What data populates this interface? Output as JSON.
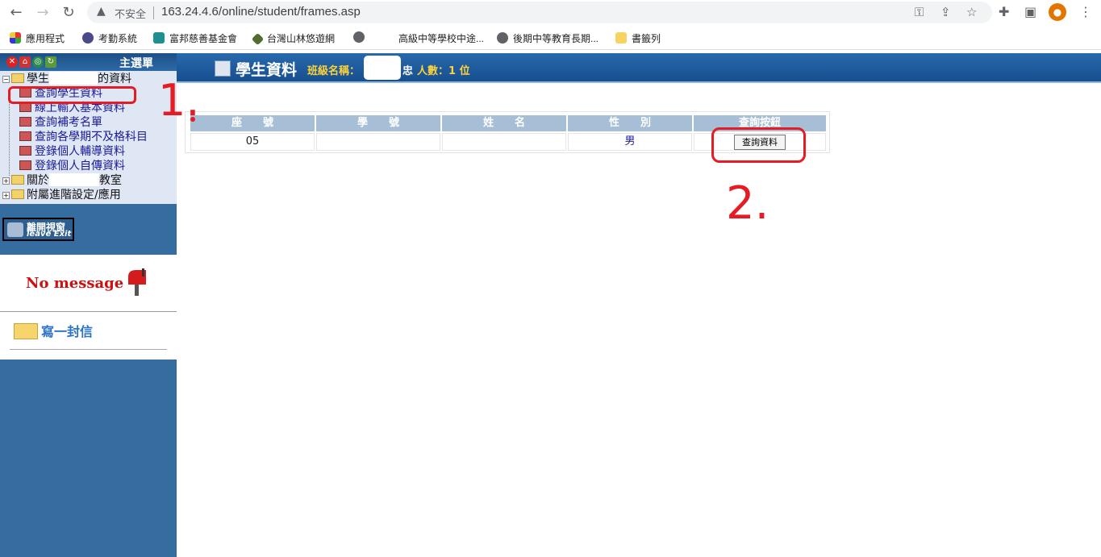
{
  "browser": {
    "insecure_label": "不安全",
    "url": "163.24.4.6/online/student/frames.asp",
    "bookmarks": [
      "應用程式",
      "考勤系統",
      "富邦慈善基金會",
      "台灣山林悠遊網",
      "",
      "高級中等學校中途...",
      "後期中等教育長期...",
      "書籤列"
    ]
  },
  "menu": {
    "title": "主選單",
    "tree": [
      {
        "label_a": "學生",
        "label_b": "的資料"
      },
      {
        "label": "查詢學生資料"
      },
      {
        "label": "線上輸入基本資料"
      },
      {
        "label": "查詢補考名單"
      },
      {
        "label": "查詢各學期不及格科目"
      },
      {
        "label": "登錄個人輔導資料"
      },
      {
        "label": "登錄個人自傳資料"
      },
      {
        "label_a": "關於",
        "label_b": "教室"
      },
      {
        "label": "附屬進階設定/應用"
      }
    ],
    "exit_label_top": "離開視窗",
    "exit_label_bottom": "leave Exit",
    "no_message": "No message",
    "write_letter": "寫一封信"
  },
  "banner": {
    "title": "學生資料",
    "class_label": "班級名稱：",
    "class_suffix": "忠",
    "count_label": "人數：1 位"
  },
  "table": {
    "headers": [
      "座　　號",
      "學　　號",
      "姓　　名",
      "性　　別",
      "查詢按鈕"
    ],
    "rows": [
      {
        "seat": "05",
        "student_id": "",
        "name": "",
        "gender": "男",
        "button": "查詢資料"
      }
    ]
  },
  "annotations": {
    "step1": "1.",
    "step2": "2."
  }
}
